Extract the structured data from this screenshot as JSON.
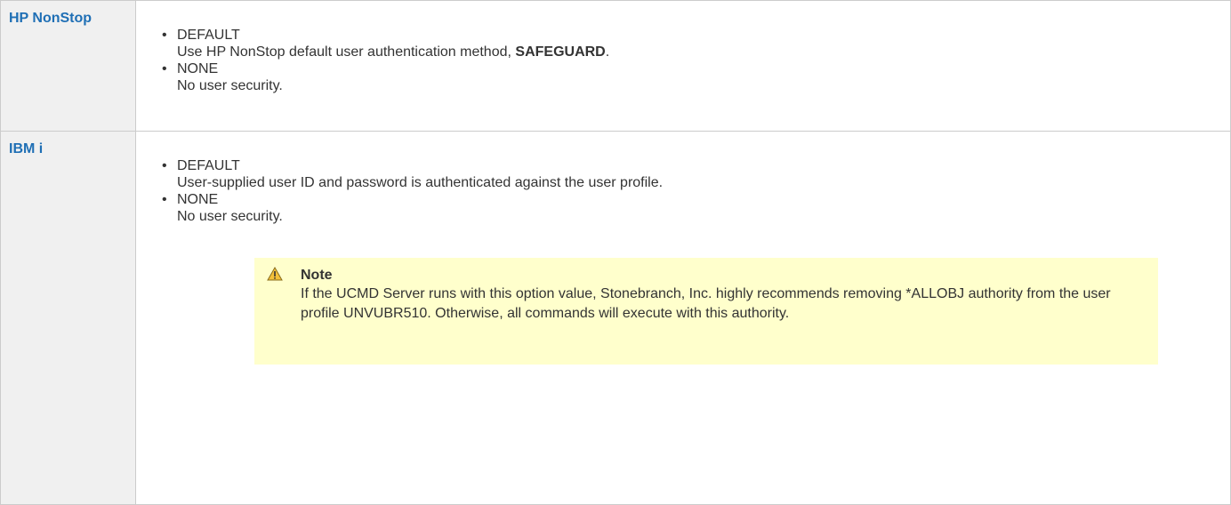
{
  "rows": [
    {
      "platform": "HP NonStop",
      "options": [
        {
          "name": "DEFAULT",
          "desc_before": "Use HP NonStop default user authentication method, ",
          "desc_bold": "SAFEGUARD",
          "desc_after": "."
        },
        {
          "name": "NONE",
          "desc": "No user security."
        }
      ]
    },
    {
      "platform": "IBM i",
      "options": [
        {
          "name": "DEFAULT",
          "desc": "User-supplied user ID and password is authenticated against the user profile."
        },
        {
          "name": "NONE",
          "desc": "No user security."
        }
      ],
      "note": {
        "icon": "warning-icon",
        "title": "Note",
        "text": "If the UCMD Server runs with this option value, Stonebranch, Inc. highly recommends removing *ALLOBJ authority from the user profile UNVUBR510. Otherwise, all commands will execute with this authority."
      }
    }
  ],
  "bullet": "•",
  "colors": {
    "platform_label": "#1f6fb5",
    "platform_bg": "#f0f0f0",
    "note_bg": "#ffffcc",
    "border": "#cccccc",
    "warning_fill": "#f3c13a"
  }
}
